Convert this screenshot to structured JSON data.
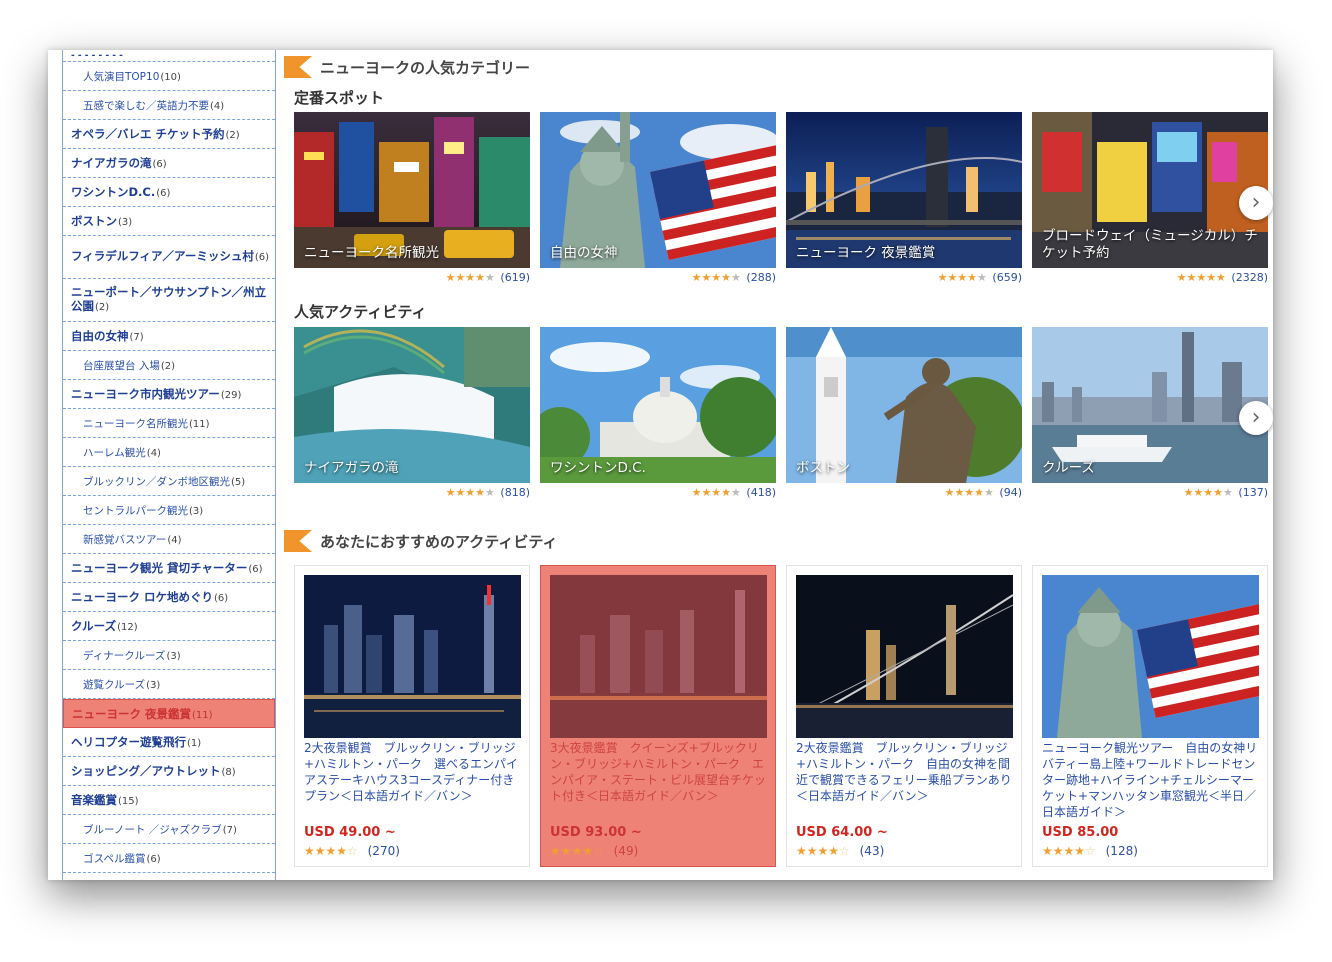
{
  "sidebar": {
    "items": [
      {
        "label": "人気演目TOP10",
        "count": "(10)",
        "sub": true
      },
      {
        "label": "五感で楽しむ／英語力不要",
        "count": "(4)",
        "sub": true
      },
      {
        "label": "オペラ／バレエ チケット予約",
        "count": "(2)"
      },
      {
        "label": "ナイアガラの滝",
        "count": "(6)"
      },
      {
        "label": "ワシントンD.C.",
        "count": "(6)"
      },
      {
        "label": "ボストン",
        "count": "(3)"
      },
      {
        "label": "フィラデルフィア／アーミッシュ村",
        "count": "(6)",
        "tall": true
      },
      {
        "label": "ニューポート／サウサンプトン／州立公園",
        "count": "(2)",
        "tall": true
      },
      {
        "label": "自由の女神",
        "count": "(7)"
      },
      {
        "label": "台座展望台 入場",
        "count": "(2)",
        "sub": true
      },
      {
        "label": "ニューヨーク市内観光ツアー",
        "count": "(29)"
      },
      {
        "label": "ニューヨーク名所観光",
        "count": "(11)",
        "sub": true
      },
      {
        "label": "ハーレム観光",
        "count": "(4)",
        "sub": true
      },
      {
        "label": "ブルックリン／ダンボ地区観光",
        "count": "(5)",
        "sub": true
      },
      {
        "label": "セントラルパーク観光",
        "count": "(3)",
        "sub": true
      },
      {
        "label": "新感覚バスツアー",
        "count": "(4)",
        "sub": true
      },
      {
        "label": "ニューヨーク観光 貸切チャーター",
        "count": "(6)"
      },
      {
        "label": "ニューヨーク ロケ地めぐり",
        "count": "(6)"
      },
      {
        "label": "クルーズ",
        "count": "(12)"
      },
      {
        "label": "ディナークルーズ",
        "count": "(3)",
        "sub": true
      },
      {
        "label": "遊覧クルーズ",
        "count": "(3)",
        "sub": true
      },
      {
        "label": "ニューヨーク 夜景鑑賞",
        "count": "(11)",
        "active": true
      },
      {
        "label": "ヘリコプター遊覧飛行",
        "count": "(1)"
      },
      {
        "label": "ショッピング／アウトレット",
        "count": "(8)"
      },
      {
        "label": "音楽鑑賞",
        "count": "(15)"
      },
      {
        "label": "ブルーノート ／ジャズクラブ",
        "count": "(7)",
        "sub": true
      },
      {
        "label": "ゴスペル鑑賞",
        "count": "(6)",
        "sub": true
      }
    ]
  },
  "categories": {
    "title": "ニューヨークの人気カテゴリー",
    "spots_title": "定番スポット",
    "spots": [
      {
        "caption": "ニューヨーク名所観光",
        "stars": "★★★★",
        "star_off": "★",
        "count": "(619)"
      },
      {
        "caption": "自由の女神",
        "stars": "★★★★",
        "star_off": "★",
        "count": "(288)"
      },
      {
        "caption": "ニューヨーク 夜景鑑賞",
        "stars": "★★★★",
        "star_off": "★",
        "count": "(659)"
      },
      {
        "caption": "ブロードウェイ（ミュージカル）チケット予約",
        "stars": "★★★★★",
        "star_off": "",
        "count": "(2328)"
      }
    ],
    "activities_title": "人気アクティビティ",
    "activities": [
      {
        "caption": "ナイアガラの滝",
        "stars": "★★★★",
        "star_off": "★",
        "count": "(818)"
      },
      {
        "caption": "ワシントンD.C.",
        "stars": "★★★★",
        "star_off": "★",
        "count": "(418)"
      },
      {
        "caption": "ボストン",
        "stars": "★★★★",
        "star_off": "★",
        "count": "(94)"
      },
      {
        "caption": "クルーズ",
        "stars": "★★★★",
        "star_off": "★",
        "count": "(137)"
      }
    ],
    "next_glyph": "›"
  },
  "recommend": {
    "title": "あなたにおすすめのアクティビティ",
    "items": [
      {
        "title": "2大夜景観賞　ブルックリン・ブリッジ+ハミルトン・パーク　選べるエンパイアステーキハウス3コースディナー付きプラン＜日本語ガイド／バン＞",
        "price": "USD 49.00 ~",
        "stars": "★★★★",
        "star_off": "☆",
        "count": "(270)"
      },
      {
        "title": "3大夜景鑑賞　クイーンズ+ブルックリン・ブリッジ+ハミルトン・パーク　エンパイア・ステート・ビル展望台チケット付き＜日本語ガイド／バン＞",
        "price": "USD 93.00 ~",
        "stars": "★★★★",
        "star_off": "☆",
        "count": "(49)"
      },
      {
        "title": "2大夜景鑑賞　ブルックリン・ブリッジ+ハミルトン・パーク　自由の女神を間近で観賞できるフェリー乗船プランあり＜日本語ガイド／バン＞",
        "price": "USD 64.00 ~",
        "stars": "★★★★",
        "star_off": "☆",
        "count": "(43)"
      },
      {
        "title": "ニューヨーク観光ツアー　自由の女神リバティー島上陸+ワールドトレードセンター跡地+ハイライン+チェルシーマーケット+マンハッタン車窓観光＜半日／日本語ガイド＞",
        "price": "USD 85.00",
        "stars": "★★★★",
        "star_off": "☆",
        "count": "(128)"
      }
    ]
  }
}
